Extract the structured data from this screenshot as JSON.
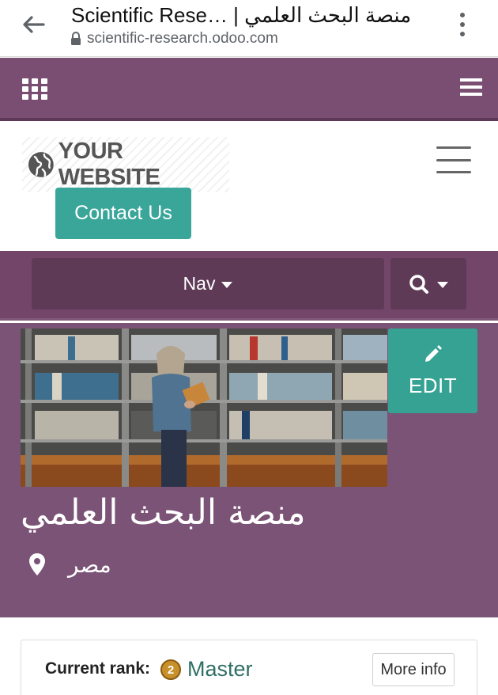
{
  "browser": {
    "page_title": "Scientific Rese… | منصة البحث العلمي",
    "url": "scientific-research.odoo.com",
    "icons": {
      "back": "arrow-left-icon",
      "lock": "lock-icon",
      "menu": "kebab-menu-icon"
    }
  },
  "odoo_bar": {
    "icons": {
      "apps": "apps-grid-icon",
      "menu": "hamburger-menu-icon"
    },
    "background": "#7a4d72"
  },
  "site_header": {
    "logo_text": "YOUR WEBSITE",
    "logo_icon": "globe-icon",
    "contact_button": "Contact Us",
    "toggle_icon": "hamburger-menu-icon",
    "accent": "#3aa69a"
  },
  "nav": {
    "dropdown_label": "Nav",
    "search_icon": "search-icon"
  },
  "profile": {
    "name": "منصة البحث العلمي",
    "location": "مصر",
    "edit_label": "EDIT",
    "edit_icon": "pencil-icon",
    "location_icon": "map-marker-icon",
    "banner_color": "#7b5376"
  },
  "rank": {
    "label": "Current rank:",
    "badge_number": "2",
    "name": "Master",
    "more_info": "More info"
  }
}
